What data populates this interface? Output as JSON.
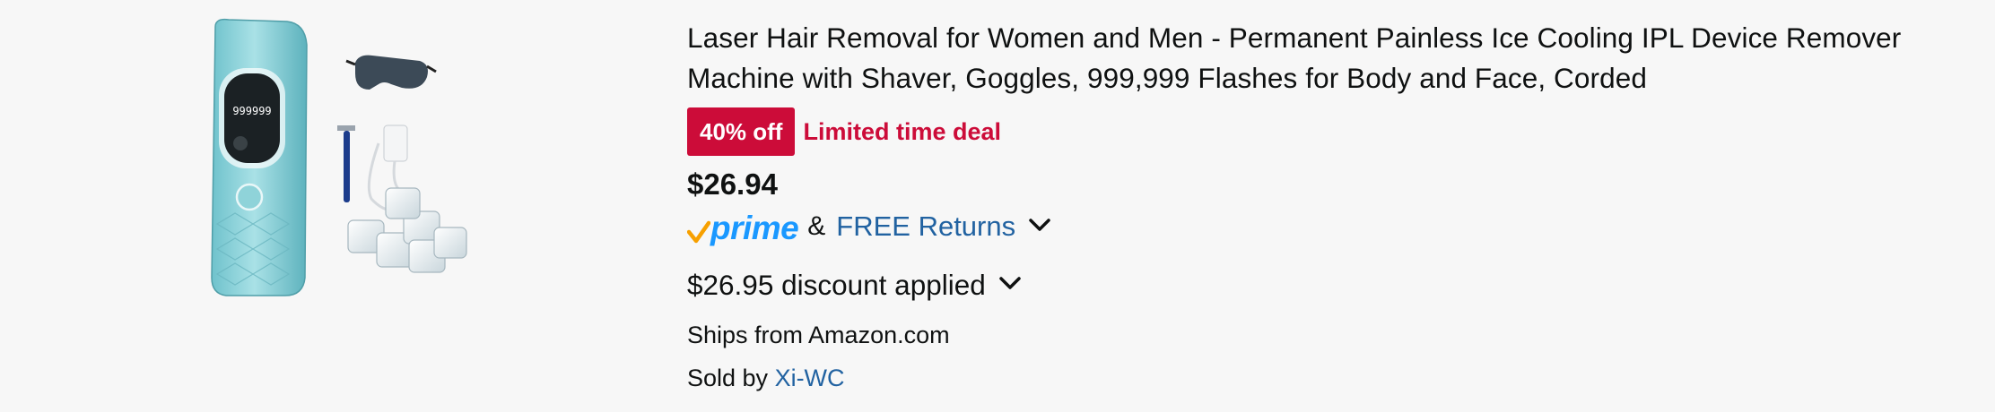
{
  "product": {
    "title": "Laser Hair Removal for Women and Men - Permanent Painless Ice Cooling IPL Device Remover Machine with Shaver, Goggles, 999,999 Flashes for Body and Face, Corded",
    "image_display": "999999"
  },
  "deal": {
    "badge": "40% off",
    "label": "Limited time deal"
  },
  "price": "$26.94",
  "prime": {
    "logo_text": "prime",
    "ampersand": "&",
    "returns_label": "FREE Returns"
  },
  "discount": {
    "text": "$26.95 discount applied"
  },
  "shipping": {
    "ships_from": "Ships from Amazon.com",
    "sold_by_prefix": "Sold by ",
    "seller": "Xi-WC"
  },
  "colors": {
    "deal_red": "#cc0c39",
    "link_blue": "#2162a1",
    "prime_blue": "#1a98ff",
    "prime_check_orange": "#f7a000",
    "background": "#f7f7f7"
  },
  "icons": [
    "prime-check-icon",
    "chevron-down-icon"
  ]
}
